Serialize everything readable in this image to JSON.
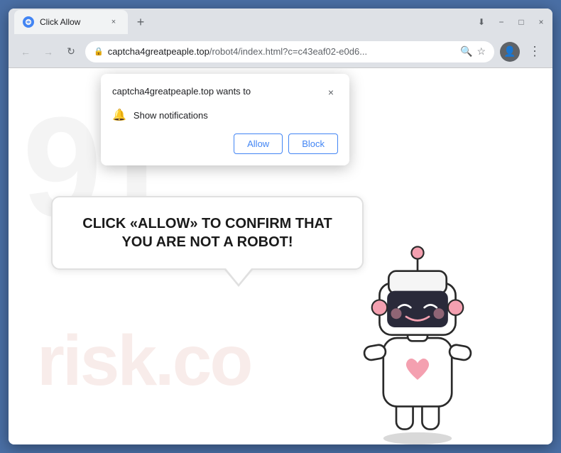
{
  "browser": {
    "title_bar": {
      "tab_label": "Click Allow",
      "new_tab_icon": "+",
      "close_icon": "×",
      "minimize_icon": "−",
      "maximize_icon": "□"
    },
    "address_bar": {
      "url_display": "captcha4greatpeaple.top/robot4/index.html?c=c43eaf02-e0d6...",
      "url_domain": "captcha4greatpeaple.top",
      "url_path": "/robot4/index.html?c=c43eaf02-e0d6...",
      "back_icon": "←",
      "forward_icon": "→",
      "refresh_icon": "↻",
      "search_icon": "🔍",
      "star_icon": "☆",
      "profile_icon": "👤",
      "more_icon": "⋮",
      "download_icon": "⬇"
    }
  },
  "notification_popup": {
    "title": "captcha4greatpeaple.top wants to",
    "permission_label": "Show notifications",
    "allow_button": "Allow",
    "block_button": "Block",
    "close_icon": "×"
  },
  "page": {
    "bubble_text": "CLICK «ALLOW» TO CONFIRM THAT YOU ARE NOT A ROBOT!",
    "watermark_text": "risk.co"
  }
}
